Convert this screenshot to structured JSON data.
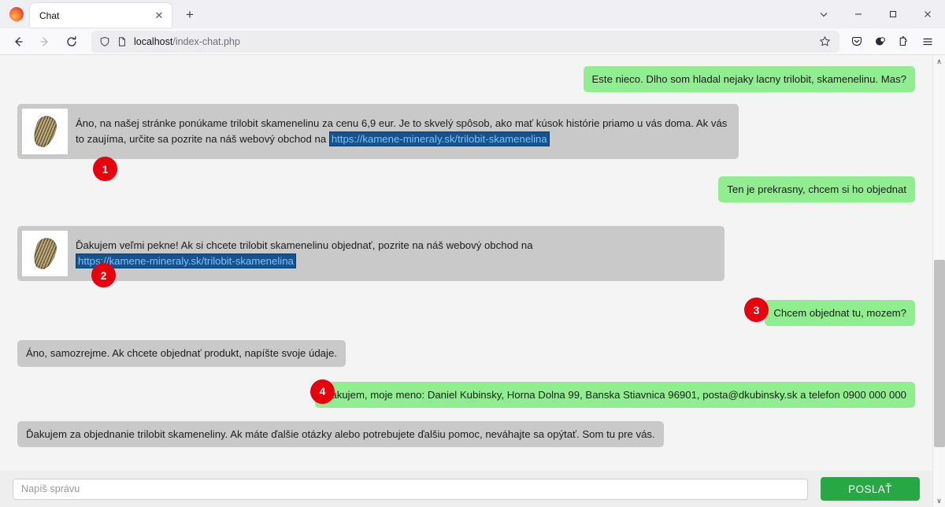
{
  "browser": {
    "tab": {
      "title": "Chat",
      "close_label": "✕"
    },
    "new_tab_label": "+",
    "window_controls": {
      "list_all_tabs": "⌄",
      "minimize": "—",
      "maximize": "❐",
      "close": "✕"
    },
    "nav": {
      "back": "←",
      "forward": "→",
      "reload": "↻"
    },
    "url": {
      "host": "localhost",
      "path": "/index-chat.php"
    },
    "toolbar_icons": [
      "shield-icon",
      "page-icon",
      "bookmark-star-icon",
      "pocket-icon",
      "account-icon",
      "extensions-icon",
      "menu-icon"
    ]
  },
  "chat": {
    "messages": [
      {
        "id": "m1",
        "sender": "user",
        "text": "Este nieco. Dlho som hladal nejaky lacny trilobit, skamenelinu. Mas?",
        "badge": null,
        "avatar": false
      },
      {
        "id": "m2",
        "sender": "bot",
        "text_before": "Áno, na našej stránke ponúkame trilobit skamenelinu za cenu 6,9 eur. Je to skvelý spôsob, ako mať kúsok histórie priamo u vás doma. Ak vás to zaujíma, určite sa pozrite na náš webový obchod na ",
        "link": "https://kamene-mineraly.sk/trilobit-skamenelina",
        "badge": "1",
        "avatar": true
      },
      {
        "id": "m3",
        "sender": "user",
        "text": "Ten je prekrasny, chcem si ho objednat",
        "badge": null,
        "avatar": false
      },
      {
        "id": "m4",
        "sender": "bot",
        "text_before": "Ďakujem veľmi pekne! Ak si chcete trilobit skamenelinu objednať, pozrite na náš webový obchod na ",
        "link": "https://kamene-mineraly.sk/trilobit-skamenelina",
        "badge": "2",
        "avatar": true
      },
      {
        "id": "m5",
        "sender": "user",
        "text": "Chcem objednat tu, mozem?",
        "badge": "3",
        "avatar": false
      },
      {
        "id": "m6",
        "sender": "bot",
        "text": "Áno, samozrejme. Ak chcete objednať produkt, napíšte svoje údaje.",
        "badge": null,
        "avatar": false
      },
      {
        "id": "m7",
        "sender": "user",
        "text": "Dakujem, moje meno: Daniel Kubinsky, Horna Dolna 99, Banska Stiavnica 96901, posta@dkubinsky.sk a telefon 0900 000 000",
        "badge": "4",
        "avatar": false
      },
      {
        "id": "m8",
        "sender": "bot",
        "text": "Ďakujem za objednanie trilobit skameneliny. Ak máte ďalšie otázky alebo potrebujete ďalšiu pomoc, neváhajte sa opýtať. Som tu pre vás.",
        "badge": null,
        "avatar": false
      }
    ]
  },
  "composer": {
    "placeholder": "Napíš správu",
    "value": "",
    "send_label": "POSLAŤ"
  },
  "colors": {
    "user_bubble": "#90ee90",
    "bot_bubble": "#c9c9c9",
    "badge": "#e8000d",
    "send_button": "#28a745",
    "link_highlight": "#16538d"
  },
  "scrollbar": {
    "up": "∧",
    "down": "∨"
  }
}
